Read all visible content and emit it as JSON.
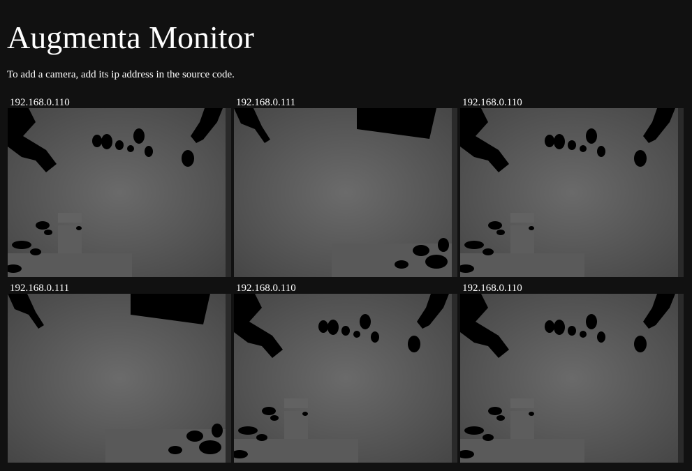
{
  "page": {
    "title": "Augmenta Monitor",
    "subtitle": "To add a camera, add its ip address in the source code."
  },
  "cameras": [
    {
      "ip": "192.168.0.110",
      "view": "room-a"
    },
    {
      "ip": "192.168.0.111",
      "view": "room-b"
    },
    {
      "ip": "192.168.0.110",
      "view": "room-a"
    },
    {
      "ip": "192.168.0.111",
      "view": "room-b"
    },
    {
      "ip": "192.168.0.110",
      "view": "room-a"
    },
    {
      "ip": "192.168.0.110",
      "view": "room-a"
    }
  ]
}
